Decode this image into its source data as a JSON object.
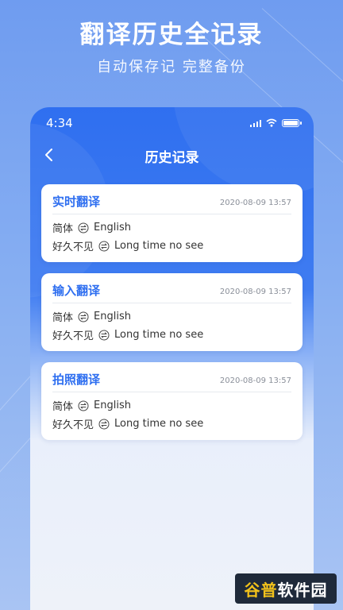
{
  "promo": {
    "headline": "翻译历史全记录",
    "subline": "自动保存记 完整备份"
  },
  "status_bar": {
    "time": "4:34",
    "icons": [
      "signal-icon",
      "wifi-icon",
      "battery-icon"
    ]
  },
  "nav": {
    "back_icon": "chevron-left-icon",
    "title": "历史记录"
  },
  "history": [
    {
      "type": "实时翻译",
      "timestamp": "2020-08-09 13:57",
      "lang_src": "简体",
      "lang_dst": "English",
      "text_src": "好久不见",
      "text_dst": "Long time no see"
    },
    {
      "type": "输入翻译",
      "timestamp": "2020-08-09 13:57",
      "lang_src": "简体",
      "lang_dst": "English",
      "text_src": "好久不见",
      "text_dst": "Long time no see"
    },
    {
      "type": "拍照翻译",
      "timestamp": "2020-08-09 13:57",
      "lang_src": "简体",
      "lang_dst": "English",
      "text_src": "好久不见",
      "text_dst": "Long time no see"
    }
  ],
  "watermark": {
    "part1": "谷普",
    "part2": "软件园"
  },
  "colors": {
    "accent": "#2f6ff0",
    "background": "#7ea6f1"
  }
}
